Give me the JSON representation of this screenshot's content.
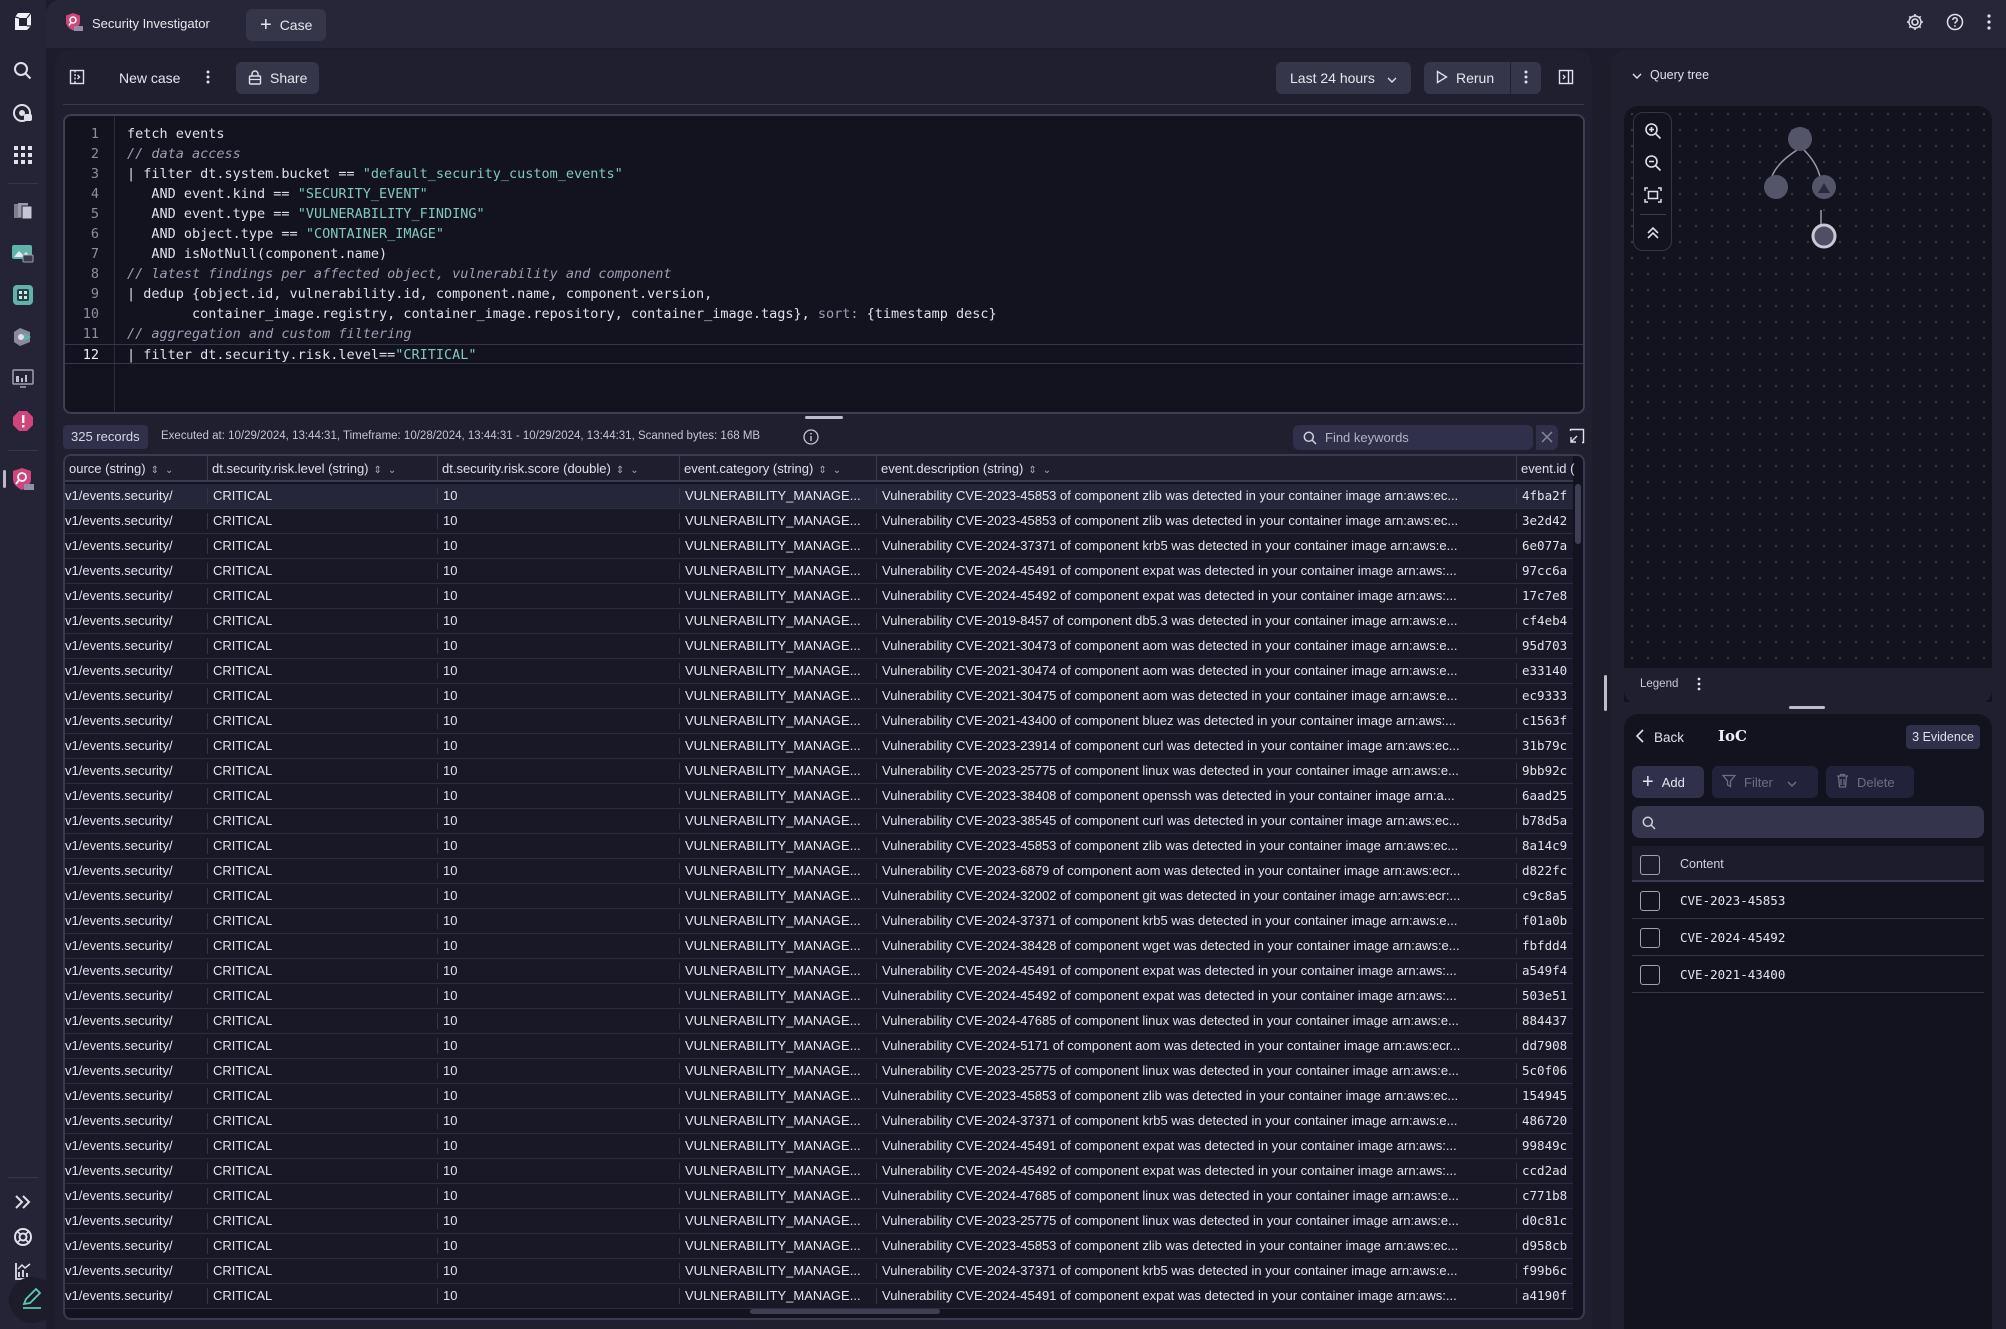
{
  "app": {
    "title": "Security Investigator",
    "case_button": "Case"
  },
  "rail": {
    "items": [
      "dynatrace-logo",
      "search",
      "copilot",
      "apps",
      "infrastructure",
      "services",
      "dashboards",
      "kubernetes",
      "frontend",
      "problems",
      "security-investigator"
    ],
    "bottom": [
      "expand",
      "support",
      "whats-new",
      "edit"
    ]
  },
  "toolbar": {
    "case_name": "New case",
    "share_label": "Share",
    "timeframe": "Last 24 hours",
    "rerun_label": "Rerun"
  },
  "editor": {
    "lines": [
      {
        "n": "1",
        "parts": [
          [
            "t",
            "fetch events"
          ]
        ]
      },
      {
        "n": "2",
        "parts": [
          [
            "c",
            "// data access"
          ]
        ]
      },
      {
        "n": "3",
        "parts": [
          [
            "t",
            "| filter dt.system.bucket == "
          ],
          [
            "s",
            "\"default_security_custom_events\""
          ]
        ]
      },
      {
        "n": "4",
        "parts": [
          [
            "t",
            "   AND event.kind == "
          ],
          [
            "s",
            "\"SECURITY_EVENT\""
          ]
        ]
      },
      {
        "n": "5",
        "parts": [
          [
            "t",
            "   AND event.type == "
          ],
          [
            "s",
            "\"VULNERABILITY_FINDING\""
          ]
        ]
      },
      {
        "n": "6",
        "parts": [
          [
            "t",
            "   AND object.type == "
          ],
          [
            "s",
            "\"CONTAINER_IMAGE\""
          ]
        ]
      },
      {
        "n": "7",
        "parts": [
          [
            "t",
            "   AND isNotNull(component.name)"
          ]
        ]
      },
      {
        "n": "8",
        "parts": [
          [
            "c",
            "// latest findings per affected object, vulnerability and component"
          ]
        ]
      },
      {
        "n": "9",
        "parts": [
          [
            "t",
            "| dedup {object.id, vulnerability.id, component.name, component.version,"
          ]
        ]
      },
      {
        "n": "10",
        "parts": [
          [
            "t",
            "        container_image.registry, container_image.repository, container_image.tags}, "
          ],
          [
            "k",
            "sort:"
          ],
          [
            "t",
            " {timestamp desc}"
          ]
        ]
      },
      {
        "n": "11",
        "parts": [
          [
            "c",
            "// aggregation and custom filtering"
          ]
        ]
      },
      {
        "n": "12",
        "parts": [
          [
            "t",
            "| filter dt.security.risk.level=="
          ],
          [
            "s",
            "\"CRITICAL\""
          ]
        ]
      }
    ],
    "active_line": 12
  },
  "results": {
    "records": "325 records",
    "exec_info": "Executed at: 10/29/2024, 13:44:31, Timeframe: 10/28/2024, 13:44:31 - 10/29/2024, 13:44:31, Scanned bytes: 168 MB",
    "find_placeholder": "Find keywords",
    "columns": [
      "ource (string)",
      "dt.security.risk.level (string)",
      "dt.security.risk.score (double)",
      "event.category (string)",
      "event.description (string)",
      "event.id ("
    ],
    "rows": [
      [
        "v1/events.security/",
        "CRITICAL",
        "10",
        "VULNERABILITY_MANAGE...",
        "Vulnerability CVE-2023-45853 of component zlib was detected in your container image arn:aws:ec...",
        "4fba2f"
      ],
      [
        "v1/events.security/",
        "CRITICAL",
        "10",
        "VULNERABILITY_MANAGE...",
        "Vulnerability CVE-2023-45853 of component zlib was detected in your container image arn:aws:ec...",
        "3e2d42"
      ],
      [
        "v1/events.security/",
        "CRITICAL",
        "10",
        "VULNERABILITY_MANAGE...",
        "Vulnerability CVE-2024-37371 of component krb5 was detected in your container image arn:aws:e...",
        "6e077a"
      ],
      [
        "v1/events.security/",
        "CRITICAL",
        "10",
        "VULNERABILITY_MANAGE...",
        "Vulnerability CVE-2024-45491 of component expat was detected in your container image arn:aws:...",
        "97cc6a"
      ],
      [
        "v1/events.security/",
        "CRITICAL",
        "10",
        "VULNERABILITY_MANAGE...",
        "Vulnerability CVE-2024-45492 of component expat was detected in your container image arn:aws:...",
        "17c7e8"
      ],
      [
        "v1/events.security/",
        "CRITICAL",
        "10",
        "VULNERABILITY_MANAGE...",
        "Vulnerability CVE-2019-8457 of component db5.3 was detected in your container image arn:aws:e...",
        "cf4eb4"
      ],
      [
        "v1/events.security/",
        "CRITICAL",
        "10",
        "VULNERABILITY_MANAGE...",
        "Vulnerability CVE-2021-30473 of component aom was detected in your container image arn:aws:e...",
        "95d703"
      ],
      [
        "v1/events.security/",
        "CRITICAL",
        "10",
        "VULNERABILITY_MANAGE...",
        "Vulnerability CVE-2021-30474 of component aom was detected in your container image arn:aws:e...",
        "e33140"
      ],
      [
        "v1/events.security/",
        "CRITICAL",
        "10",
        "VULNERABILITY_MANAGE...",
        "Vulnerability CVE-2021-30475 of component aom was detected in your container image arn:aws:e...",
        "ec9333"
      ],
      [
        "v1/events.security/",
        "CRITICAL",
        "10",
        "VULNERABILITY_MANAGE...",
        "Vulnerability CVE-2021-43400 of component bluez was detected in your container image arn:aws:...",
        "c1563f"
      ],
      [
        "v1/events.security/",
        "CRITICAL",
        "10",
        "VULNERABILITY_MANAGE...",
        "Vulnerability CVE-2023-23914 of component curl was detected in your container image arn:aws:ec...",
        "31b79c"
      ],
      [
        "v1/events.security/",
        "CRITICAL",
        "10",
        "VULNERABILITY_MANAGE...",
        "Vulnerability CVE-2023-25775 of component linux was detected in your container image arn:aws:e...",
        "9bb92c"
      ],
      [
        "v1/events.security/",
        "CRITICAL",
        "10",
        "VULNERABILITY_MANAGE...",
        "Vulnerability CVE-2023-38408 of component openssh was detected in your container image arn:a...",
        "6aad25"
      ],
      [
        "v1/events.security/",
        "CRITICAL",
        "10",
        "VULNERABILITY_MANAGE...",
        "Vulnerability CVE-2023-38545 of component curl was detected in your container image arn:aws:ec...",
        "b78d5a"
      ],
      [
        "v1/events.security/",
        "CRITICAL",
        "10",
        "VULNERABILITY_MANAGE...",
        "Vulnerability CVE-2023-45853 of component zlib was detected in your container image arn:aws:ec...",
        "8a14c9"
      ],
      [
        "v1/events.security/",
        "CRITICAL",
        "10",
        "VULNERABILITY_MANAGE...",
        "Vulnerability CVE-2023-6879 of component aom was detected in your container image arn:aws:ecr...",
        "d822fc"
      ],
      [
        "v1/events.security/",
        "CRITICAL",
        "10",
        "VULNERABILITY_MANAGE...",
        "Vulnerability CVE-2024-32002 of component git was detected in your container image arn:aws:ecr:...",
        "c9c8a5"
      ],
      [
        "v1/events.security/",
        "CRITICAL",
        "10",
        "VULNERABILITY_MANAGE...",
        "Vulnerability CVE-2024-37371 of component krb5 was detected in your container image arn:aws:e...",
        "f01a0b"
      ],
      [
        "v1/events.security/",
        "CRITICAL",
        "10",
        "VULNERABILITY_MANAGE...",
        "Vulnerability CVE-2024-38428 of component wget was detected in your container image arn:aws:e...",
        "fbfdd4"
      ],
      [
        "v1/events.security/",
        "CRITICAL",
        "10",
        "VULNERABILITY_MANAGE...",
        "Vulnerability CVE-2024-45491 of component expat was detected in your container image arn:aws:...",
        "a549f4"
      ],
      [
        "v1/events.security/",
        "CRITICAL",
        "10",
        "VULNERABILITY_MANAGE...",
        "Vulnerability CVE-2024-45492 of component expat was detected in your container image arn:aws:...",
        "503e51"
      ],
      [
        "v1/events.security/",
        "CRITICAL",
        "10",
        "VULNERABILITY_MANAGE...",
        "Vulnerability CVE-2024-47685 of component linux was detected in your container image arn:aws:e...",
        "884437"
      ],
      [
        "v1/events.security/",
        "CRITICAL",
        "10",
        "VULNERABILITY_MANAGE...",
        "Vulnerability CVE-2024-5171 of component aom was detected in your container image arn:aws:ecr...",
        "dd7908"
      ],
      [
        "v1/events.security/",
        "CRITICAL",
        "10",
        "VULNERABILITY_MANAGE...",
        "Vulnerability CVE-2023-25775 of component linux was detected in your container image arn:aws:e...",
        "5c0f06"
      ],
      [
        "v1/events.security/",
        "CRITICAL",
        "10",
        "VULNERABILITY_MANAGE...",
        "Vulnerability CVE-2023-45853 of component zlib was detected in your container image arn:aws:ec...",
        "154945"
      ],
      [
        "v1/events.security/",
        "CRITICAL",
        "10",
        "VULNERABILITY_MANAGE...",
        "Vulnerability CVE-2024-37371 of component krb5 was detected in your container image arn:aws:e...",
        "486720"
      ],
      [
        "v1/events.security/",
        "CRITICAL",
        "10",
        "VULNERABILITY_MANAGE...",
        "Vulnerability CVE-2024-45491 of component expat was detected in your container image arn:aws:...",
        "99849c"
      ],
      [
        "v1/events.security/",
        "CRITICAL",
        "10",
        "VULNERABILITY_MANAGE...",
        "Vulnerability CVE-2024-45492 of component expat was detected in your container image arn:aws:...",
        "ccd2ad"
      ],
      [
        "v1/events.security/",
        "CRITICAL",
        "10",
        "VULNERABILITY_MANAGE...",
        "Vulnerability CVE-2024-47685 of component linux was detected in your container image arn:aws:e...",
        "c771b8"
      ],
      [
        "v1/events.security/",
        "CRITICAL",
        "10",
        "VULNERABILITY_MANAGE...",
        "Vulnerability CVE-2023-25775 of component linux was detected in your container image arn:aws:e...",
        "d0c81c"
      ],
      [
        "v1/events.security/",
        "CRITICAL",
        "10",
        "VULNERABILITY_MANAGE...",
        "Vulnerability CVE-2023-45853 of component zlib was detected in your container image arn:aws:ec...",
        "d958cb"
      ],
      [
        "v1/events.security/",
        "CRITICAL",
        "10",
        "VULNERABILITY_MANAGE...",
        "Vulnerability CVE-2024-37371 of component krb5 was detected in your container image arn:aws:e...",
        "f99b6c"
      ],
      [
        "v1/events.security/",
        "CRITICAL",
        "10",
        "VULNERABILITY_MANAGE...",
        "Vulnerability CVE-2024-45491 of component expat was detected in your container image arn:aws:...",
        "a4190f"
      ]
    ]
  },
  "query_tree": {
    "title": "Query tree",
    "legend_label": "Legend"
  },
  "ioc": {
    "back_label": "Back",
    "title": "IoC",
    "evidence_badge": "3 Evidence",
    "add_label": "Add",
    "filter_label": "Filter",
    "delete_label": "Delete",
    "search_value": "",
    "column_header": "Content",
    "items": [
      "CVE-2023-45853",
      "CVE-2024-45492",
      "CVE-2021-43400"
    ]
  },
  "colors": {
    "accent_teal": "#7fc9c0",
    "security_pink": "#d0457a"
  }
}
